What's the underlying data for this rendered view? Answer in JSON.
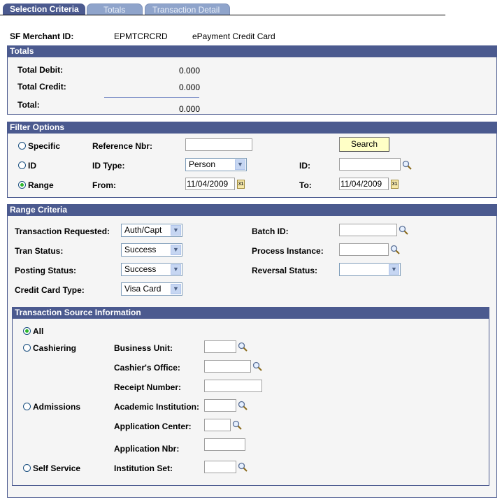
{
  "tabs": [
    {
      "label": "Selection Criteria",
      "active": true
    },
    {
      "label": "Totals",
      "active": false
    },
    {
      "label": "Transaction Detail",
      "active": false
    }
  ],
  "merchant": {
    "label": "SF Merchant ID:",
    "id": "EPMTCRCRD",
    "description": "ePayment Credit Card"
  },
  "totals": {
    "header": "Totals",
    "debit_label": "Total Debit:",
    "debit_value": "0.000",
    "credit_label": "Total Credit:",
    "credit_value": "0.000",
    "total_label": "Total:",
    "total_value": "0.000"
  },
  "filter": {
    "header": "Filter Options",
    "options": [
      {
        "label": "Specific",
        "selected": false
      },
      {
        "label": "ID",
        "selected": false
      },
      {
        "label": "Range",
        "selected": true
      }
    ],
    "reference_label": "Reference Nbr:",
    "reference_value": "",
    "search_button": "Search",
    "id_type_label": "ID Type:",
    "id_type_value": "Person",
    "id_label": "ID:",
    "id_value": "",
    "from_label": "From:",
    "from_value": "11/04/2009",
    "to_label": "To:",
    "to_value": "11/04/2009"
  },
  "range": {
    "header": "Range Criteria",
    "transaction_requested_label": "Transaction Requested:",
    "transaction_requested_value": "Auth/Capt",
    "tran_status_label": "Tran Status:",
    "tran_status_value": "Success",
    "posting_status_label": "Posting Status:",
    "posting_status_value": "Success",
    "card_type_label": "Credit Card Type:",
    "card_type_value": "Visa Card",
    "batch_id_label": "Batch ID:",
    "batch_id_value": "",
    "process_instance_label": "Process Instance:",
    "process_instance_value": "",
    "reversal_status_label": "Reversal Status:",
    "reversal_status_value": ""
  },
  "source": {
    "header": "Transaction Source Information",
    "options": [
      {
        "label": "All",
        "selected": true
      },
      {
        "label": "Cashiering",
        "selected": false
      },
      {
        "label": "Admissions",
        "selected": false
      },
      {
        "label": "Self Service",
        "selected": false
      }
    ],
    "business_unit_label": "Business Unit:",
    "cashiers_office_label": "Cashier's Office:",
    "receipt_number_label": "Receipt Number:",
    "academic_institution_label": "Academic Institution:",
    "application_center_label": "Application Center:",
    "application_nbr_label": "Application Nbr:",
    "institution_set_label": "Institution Set:"
  },
  "colors": {
    "header_bg": "#4b5a8f",
    "tab_inactive": "#8fa4cb",
    "button_bg": "#ffffc6",
    "panel_bg": "#f5f5f5"
  }
}
